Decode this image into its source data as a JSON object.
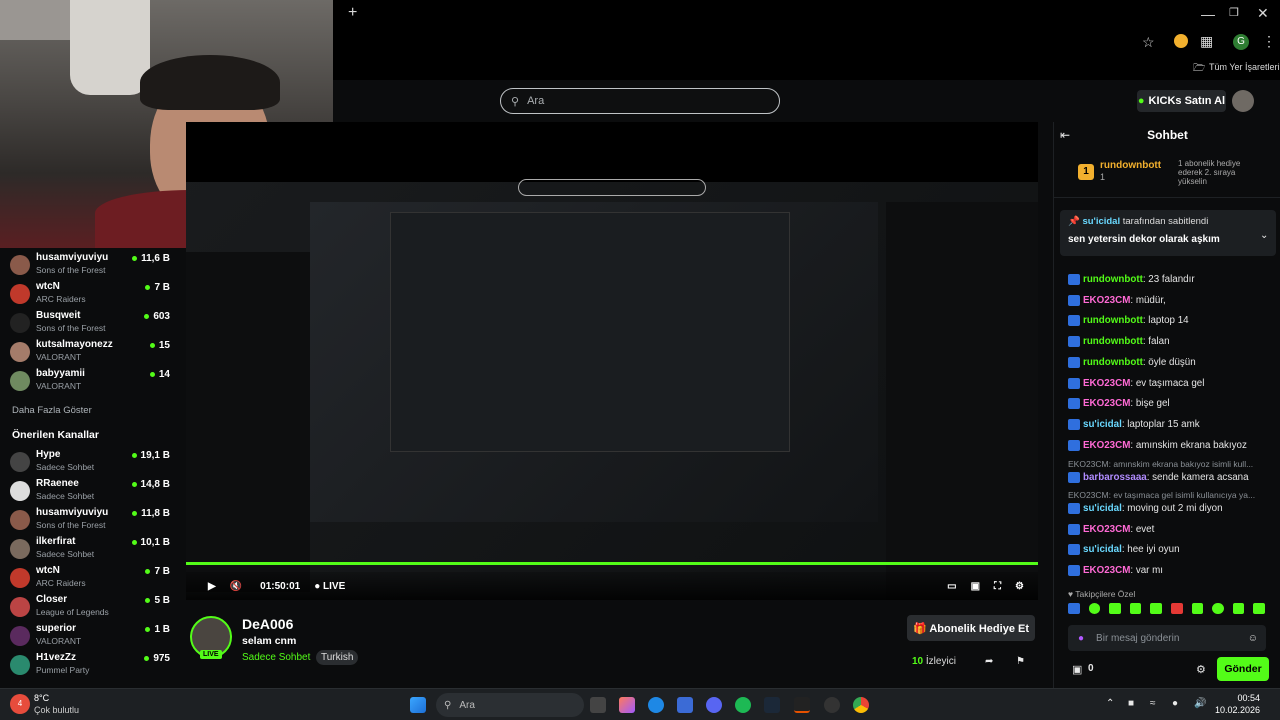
{
  "browser": {
    "new_tab": "+",
    "bookmarks_label": "Tüm Yer İşaretleri",
    "profile_initial": "G"
  },
  "site": {
    "search_placeholder": "Ara",
    "kicks_label": "KICKs Satın Al"
  },
  "sidebar": {
    "top_channels": [
      {
        "name": "husamviyuviyu",
        "game": "Sons of the Forest",
        "viewers": "11,6 B"
      },
      {
        "name": "wtcN",
        "game": "ARC Raiders",
        "viewers": "7 B"
      },
      {
        "name": "Busqweit",
        "game": "Sons of the Forest",
        "viewers": "603"
      },
      {
        "name": "kutsalmayonezz",
        "game": "VALORANT",
        "viewers": "15"
      },
      {
        "name": "babyyamii",
        "game": "VALORANT",
        "viewers": "14"
      }
    ],
    "show_more": "Daha Fazla Göster",
    "recommended_title": "Önerilen Kanallar",
    "recommended": [
      {
        "name": "Hype",
        "game": "Sadece Sohbet",
        "viewers": "19,1 B"
      },
      {
        "name": "RRaenee",
        "game": "Sadece Sohbet",
        "viewers": "14,8 B"
      },
      {
        "name": "husamviyuviyu",
        "game": "Sons of the Forest",
        "viewers": "11,8 B"
      },
      {
        "name": "ilkerfirat",
        "game": "Sadece Sohbet",
        "viewers": "10,1 B"
      },
      {
        "name": "wtcN",
        "game": "ARC Raiders",
        "viewers": "7 B"
      },
      {
        "name": "Closer",
        "game": "League of Legends",
        "viewers": "5 B"
      },
      {
        "name": "superior",
        "game": "VALORANT",
        "viewers": "1 B"
      },
      {
        "name": "H1vezZz",
        "game": "Pummel Party",
        "viewers": "975"
      }
    ]
  },
  "player": {
    "time": "01:50:01",
    "live": "LIVE"
  },
  "stream": {
    "name": "DeA006",
    "title": "selam cnm",
    "category": "Sadece Sohbet",
    "tag": "Turkish",
    "live_badge": "LIVE",
    "gift_button": "Abonelik Hediye Et",
    "viewers": "10",
    "viewers_label": "İzleyici"
  },
  "chat": {
    "title": "Sohbet",
    "gifter_name": "rundownbott",
    "gifter_count": "1",
    "gift_info": "1 abonelik hediye ederek 2. sıraya yükselin",
    "pinned_by": "su'icidal",
    "pinned_suffix": "tarafından sabitlendi",
    "pinned_text": "sen yetersin dekor olarak aşkım",
    "messages": [
      {
        "user": "rundownbott",
        "text": ": 23 falandır",
        "color": "#53fc18"
      },
      {
        "user": "EKO23CM",
        "text": ": müdür,",
        "color": "#ff6ad5"
      },
      {
        "user": "rundownbott",
        "text": ": laptop 14",
        "color": "#53fc18"
      },
      {
        "user": "rundownbott",
        "text": ": falan",
        "color": "#53fc18"
      },
      {
        "user": "rundownbott",
        "text": ": öyle düşün",
        "color": "#53fc18"
      },
      {
        "user": "EKO23CM",
        "text": ": ev taşımaca gel",
        "color": "#ff6ad5"
      },
      {
        "user": "EKO23CM",
        "text": ": bişe gel",
        "color": "#ff6ad5"
      },
      {
        "user": "su'icidal",
        "text": ": laptoplar 15 amk",
        "color": "#6ad9ff"
      },
      {
        "user": "EKO23CM",
        "text": ": amınskim ekrana bakıyoz",
        "color": "#ff6ad5"
      }
    ],
    "reply1": "EKO23CM: amınskim ekrana bakıyoz isimli kull...",
    "msg_after1": {
      "user": "barbarossaaa",
      "text": ": sende kamera acsana",
      "color": "#b18cff"
    },
    "reply2": "EKO23CM: ev taşımaca gel isimli kullanıcıya ya...",
    "messages2": [
      {
        "user": "su'icidal",
        "text": ": moving out 2 mi diyon",
        "color": "#6ad9ff"
      },
      {
        "user": "EKO23CM",
        "text": ": evet",
        "color": "#ff6ad5"
      },
      {
        "user": "su'icidal",
        "text": ": hee iyi oyun",
        "color": "#6ad9ff"
      },
      {
        "user": "EKO23CM",
        "text": ": var mı",
        "color": "#ff6ad5"
      }
    ],
    "followers_emotes": "Takipçilere Özel",
    "input_placeholder": "Bir mesaj gönderin",
    "points": "0",
    "send_button": "Gönder"
  },
  "taskbar": {
    "weather_temp": "8°C",
    "weather_desc": "Çok bulutlu",
    "search_placeholder": "Ara",
    "time": "00:54",
    "date": "10.02.2026",
    "weather_badge": "4"
  },
  "colors": {
    "accent": "#53fc18",
    "bg": "#0b0c0d"
  }
}
